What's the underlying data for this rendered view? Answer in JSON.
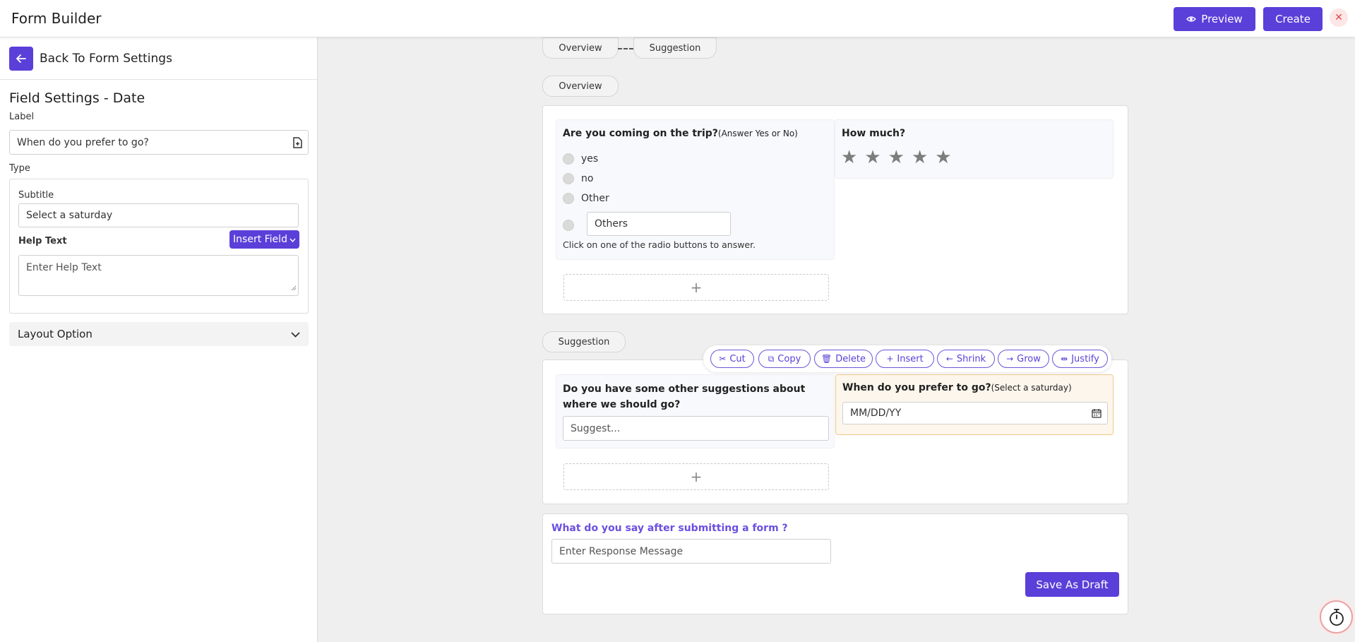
{
  "header": {
    "title": "Form Builder",
    "preview_label": "Preview",
    "create_label": "Create",
    "close_symbol": "✕"
  },
  "sidebar": {
    "back_label": "Back To Form Settings",
    "section_title": "Field Settings - Date",
    "label_caption": "Label",
    "label_value": "When do you prefer to go?",
    "type_caption": "Type",
    "subtitle_caption": "Subtitle",
    "subtitle_value": "Select a saturday",
    "help_text_caption": "Help Text",
    "insert_field_label": "Insert Field",
    "help_text_placeholder": "Enter Help Text",
    "layout_option_label": "Layout Option"
  },
  "steps": {
    "tabs": [
      "Overview",
      "Suggestion"
    ]
  },
  "sections": [
    {
      "name": "Overview",
      "radio_question": {
        "title": "Are you coming on the trip?",
        "subtitle": "(Answer Yes or No)",
        "options": [
          "yes",
          "no",
          "Other"
        ],
        "other_input_value": "Others",
        "help_text": "Click on one of the radio buttons to answer."
      },
      "rating_question": {
        "title": "How much?",
        "stars": 5,
        "star_glyph": "★"
      },
      "add_symbol": "+"
    },
    {
      "name": "Suggestion",
      "text_question": {
        "title": "Do you have some other suggestions about where we should go?",
        "placeholder": "Suggest..."
      },
      "date_question": {
        "title": "When do you prefer to go?",
        "subtitle": "(Select a saturday)",
        "placeholder": "MM/DD/YY"
      },
      "add_symbol": "+"
    }
  ],
  "toolbar": {
    "cut": "Cut",
    "copy": "Copy",
    "delete": "Delete",
    "insert": "Insert",
    "shrink": "Shrink",
    "grow": "Grow",
    "justify": "Justify"
  },
  "response": {
    "label": "What do you say after submitting a form ?",
    "placeholder": "Enter Response Message",
    "save_draft_label": "Save As Draft"
  },
  "colors": {
    "accent": "#5b3fd9",
    "selected_field_bg": "#fdf6ec",
    "selected_field_border": "#f1c98a"
  }
}
